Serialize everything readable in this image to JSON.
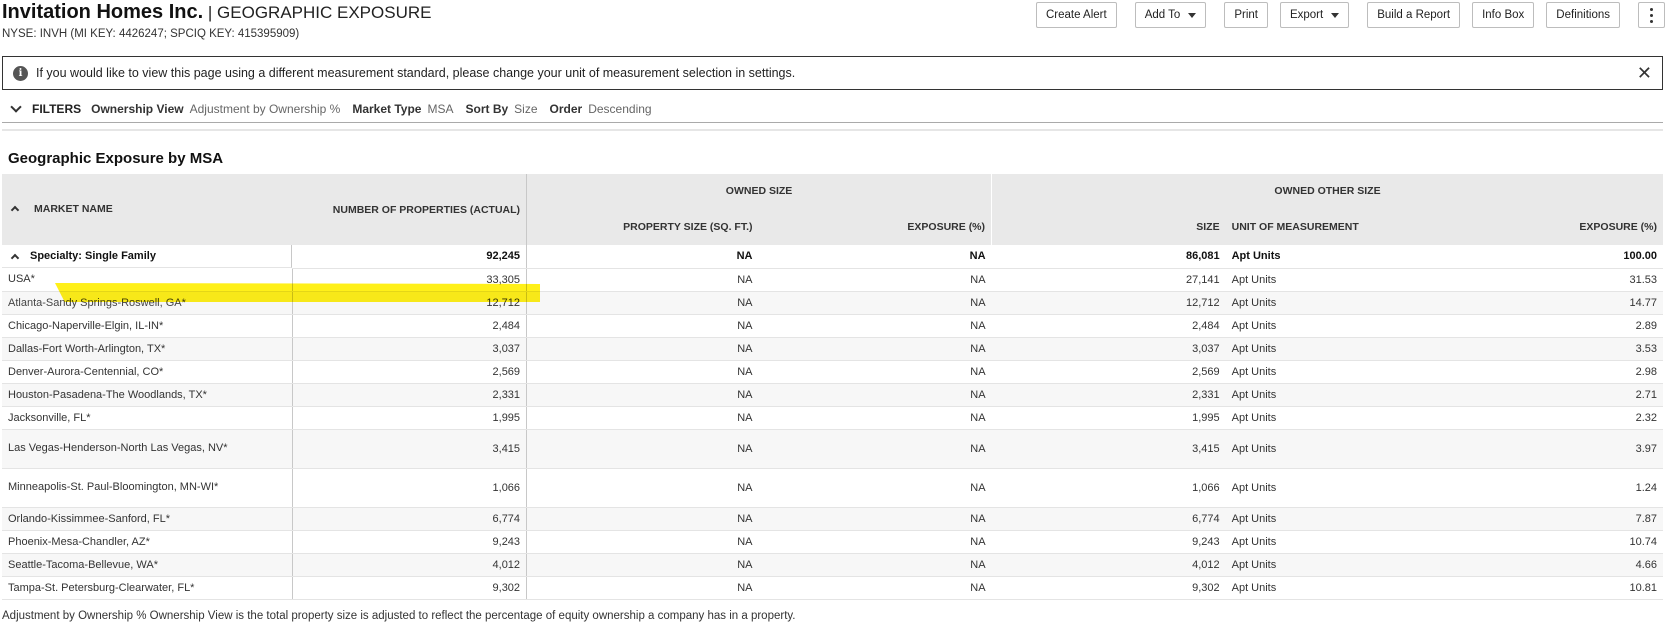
{
  "header": {
    "company": "Invitation Homes Inc.",
    "separator": " | ",
    "page_title": "GEOGRAPHIC EXPOSURE",
    "subline": "NYSE: INVH (MI KEY: 4426247; SPCIQ KEY: 415395909)"
  },
  "toolbar": {
    "create_alert": "Create Alert",
    "add_to": "Add To",
    "print": "Print",
    "export": "Export",
    "build_report": "Build a Report",
    "info_box": "Info Box",
    "definitions": "Definitions"
  },
  "notice": {
    "icon": "i",
    "text": "If you would like to view this page using a different measurement standard, please change your unit of measurement selection in settings.",
    "close": "✕"
  },
  "filters": {
    "title": "FILTERS",
    "items": [
      {
        "key": "Ownership View",
        "value": "Adjustment by Ownership %"
      },
      {
        "key": "Market Type",
        "value": "MSA"
      },
      {
        "key": "Sort By",
        "value": "Size"
      },
      {
        "key": "Order",
        "value": "Descending"
      }
    ]
  },
  "section_title": "Geographic Exposure by MSA",
  "table": {
    "headers": {
      "market_name": "MARKET NAME",
      "num_properties": "NUMBER OF PROPERTIES (ACTUAL)",
      "owned_size": "OWNED SIZE",
      "owned_other_size": "OWNED OTHER SIZE",
      "property_size": "PROPERTY SIZE (SQ. FT.)",
      "exposure_pct": "EXPOSURE (%)",
      "size": "SIZE",
      "unit_of_measurement": "UNIT OF MEASUREMENT",
      "exposure_pct_other": "EXPOSURE (%)"
    },
    "group": {
      "name": "Specialty: Single Family",
      "properties": "92,245",
      "property_size": "NA",
      "exposure": "NA",
      "size": "86,081",
      "unit": "Apt Units",
      "exposure_other": "100.00"
    },
    "rows": [
      {
        "name": "USA*",
        "properties": "33,305",
        "property_size": "NA",
        "exposure": "NA",
        "size": "27,141",
        "unit": "Apt Units",
        "exposure_other": "31.53"
      },
      {
        "name": "Atlanta-Sandy Springs-Roswell, GA*",
        "properties": "12,712",
        "property_size": "NA",
        "exposure": "NA",
        "size": "12,712",
        "unit": "Apt Units",
        "exposure_other": "14.77"
      },
      {
        "name": "Chicago-Naperville-Elgin, IL-IN*",
        "properties": "2,484",
        "property_size": "NA",
        "exposure": "NA",
        "size": "2,484",
        "unit": "Apt Units",
        "exposure_other": "2.89"
      },
      {
        "name": "Dallas-Fort Worth-Arlington, TX*",
        "properties": "3,037",
        "property_size": "NA",
        "exposure": "NA",
        "size": "3,037",
        "unit": "Apt Units",
        "exposure_other": "3.53"
      },
      {
        "name": "Denver-Aurora-Centennial, CO*",
        "properties": "2,569",
        "property_size": "NA",
        "exposure": "NA",
        "size": "2,569",
        "unit": "Apt Units",
        "exposure_other": "2.98"
      },
      {
        "name": "Houston-Pasadena-The Woodlands, TX*",
        "properties": "2,331",
        "property_size": "NA",
        "exposure": "NA",
        "size": "2,331",
        "unit": "Apt Units",
        "exposure_other": "2.71"
      },
      {
        "name": "Jacksonville, FL*",
        "properties": "1,995",
        "property_size": "NA",
        "exposure": "NA",
        "size": "1,995",
        "unit": "Apt Units",
        "exposure_other": "2.32"
      },
      {
        "name": "Las Vegas-Henderson-North Las Vegas, NV*",
        "properties": "3,415",
        "property_size": "NA",
        "exposure": "NA",
        "size": "3,415",
        "unit": "Apt Units",
        "exposure_other": "3.97"
      },
      {
        "name": "Minneapolis-St. Paul-Bloomington, MN-WI*",
        "properties": "1,066",
        "property_size": "NA",
        "exposure": "NA",
        "size": "1,066",
        "unit": "Apt Units",
        "exposure_other": "1.24"
      },
      {
        "name": "Orlando-Kissimmee-Sanford, FL*",
        "properties": "6,774",
        "property_size": "NA",
        "exposure": "NA",
        "size": "6,774",
        "unit": "Apt Units",
        "exposure_other": "7.87"
      },
      {
        "name": "Phoenix-Mesa-Chandler, AZ*",
        "properties": "9,243",
        "property_size": "NA",
        "exposure": "NA",
        "size": "9,243",
        "unit": "Apt Units",
        "exposure_other": "10.74"
      },
      {
        "name": "Seattle-Tacoma-Bellevue, WA*",
        "properties": "4,012",
        "property_size": "NA",
        "exposure": "NA",
        "size": "4,012",
        "unit": "Apt Units",
        "exposure_other": "4.66"
      },
      {
        "name": "Tampa-St. Petersburg-Clearwater, FL*",
        "properties": "9,302",
        "property_size": "NA",
        "exposure": "NA",
        "size": "9,302",
        "unit": "Apt Units",
        "exposure_other": "10.81"
      }
    ]
  },
  "footer_note": "Adjustment by Ownership % Ownership View is the total property size is adjusted to reflect the percentage of equity ownership a company has in a property.",
  "colors": {
    "link": "#2b6cb0",
    "highlight": "#ffee00",
    "header_bg": "#e9e9e9"
  }
}
